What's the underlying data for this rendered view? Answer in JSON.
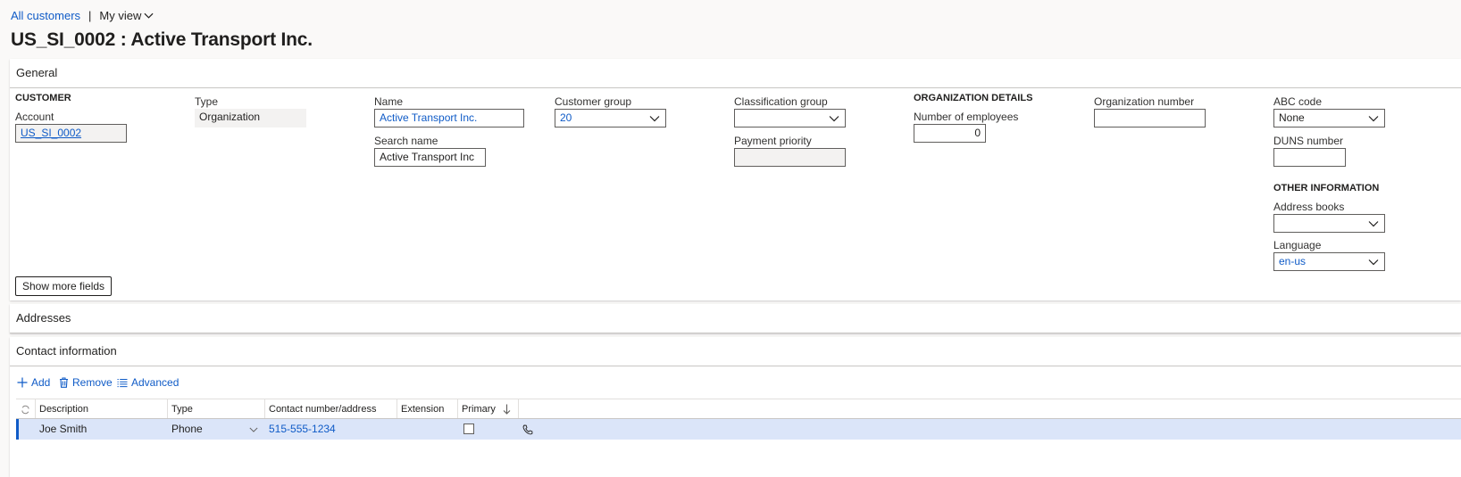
{
  "breadcrumb": {
    "parent": "All customers",
    "separator": "|",
    "view": "My view"
  },
  "page_title": "US_SI_0002 : Active Transport Inc.",
  "general": {
    "header": "General",
    "customer_group_head": "CUSTOMER",
    "account_label": "Account",
    "account_value": "US_SI_0002",
    "type_label": "Type",
    "type_value": "Organization",
    "name_label": "Name",
    "name_value": "Active Transport Inc.",
    "search_name_label": "Search name",
    "search_name_value": "Active Transport Inc",
    "customer_group_label": "Customer group",
    "customer_group_value": "20",
    "classification_group_label": "Classification group",
    "classification_group_value": "",
    "payment_priority_label": "Payment priority",
    "payment_priority_value": "",
    "org_details_head": "ORGANIZATION DETAILS",
    "employees_label": "Number of employees",
    "employees_value": "0",
    "org_number_label": "Organization number",
    "org_number_value": "",
    "abc_code_label": "ABC code",
    "abc_code_value": "None",
    "duns_label": "DUNS number",
    "duns_value": "",
    "other_info_head": "OTHER INFORMATION",
    "address_books_label": "Address books",
    "address_books_value": "",
    "language_label": "Language",
    "language_value": "en-us",
    "show_more_label": "Show more fields"
  },
  "addresses": {
    "header": "Addresses"
  },
  "contact": {
    "header": "Contact information",
    "toolbar": {
      "add": "Add",
      "remove": "Remove",
      "advanced": "Advanced"
    },
    "columns": [
      "Description",
      "Type",
      "Contact number/address",
      "Extension",
      "Primary"
    ],
    "rows": [
      {
        "description": "Joe Smith",
        "type": "Phone",
        "contact": "515-555-1234",
        "extension": "",
        "primary": false
      }
    ]
  },
  "colors": {
    "accent": "#0f5bc7",
    "selected_row": "#dbe5f9"
  }
}
